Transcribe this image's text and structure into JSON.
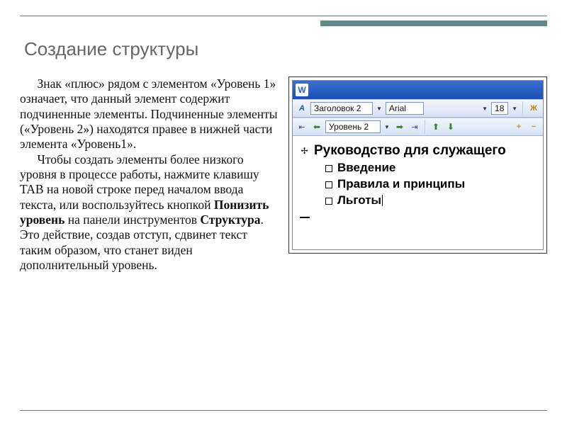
{
  "slide": {
    "title": "Создание структуры",
    "paragraph1_parts": {
      "p1": "Знак «плюс» рядом с элементом «Уровень 1» означает, что данный элемент содержит подчиненные элементы. Подчиненные элементы («Уровень 2») находятся правее в нижней части элемента «Уровень1»."
    },
    "paragraph2": {
      "t1": "Чтобы создать элементы более низкого уровня в процессе работы, нажмите клавишу TAB на новой строке перед началом ввода текста, или воспользуйтесь кнопкой ",
      "b1": "Понизить уровень",
      "t2": " на панели инструментов ",
      "b2": "Структура",
      "t3": ". Это действие, создав отступ, сдвинет текст таким образом, что станет виден дополнительный уровень."
    }
  },
  "word": {
    "icon": "W",
    "toolbar1": {
      "style_field": "Заголовок 2",
      "font_field": "Arial",
      "size_field": "18",
      "bold": "Ж"
    },
    "toolbar2": {
      "level_field": "Уровень 2"
    },
    "doc": {
      "line1": "Руководство для служащего",
      "sub1": "Введение",
      "sub2": "Правила и принципы",
      "sub3": "Льготы"
    }
  }
}
